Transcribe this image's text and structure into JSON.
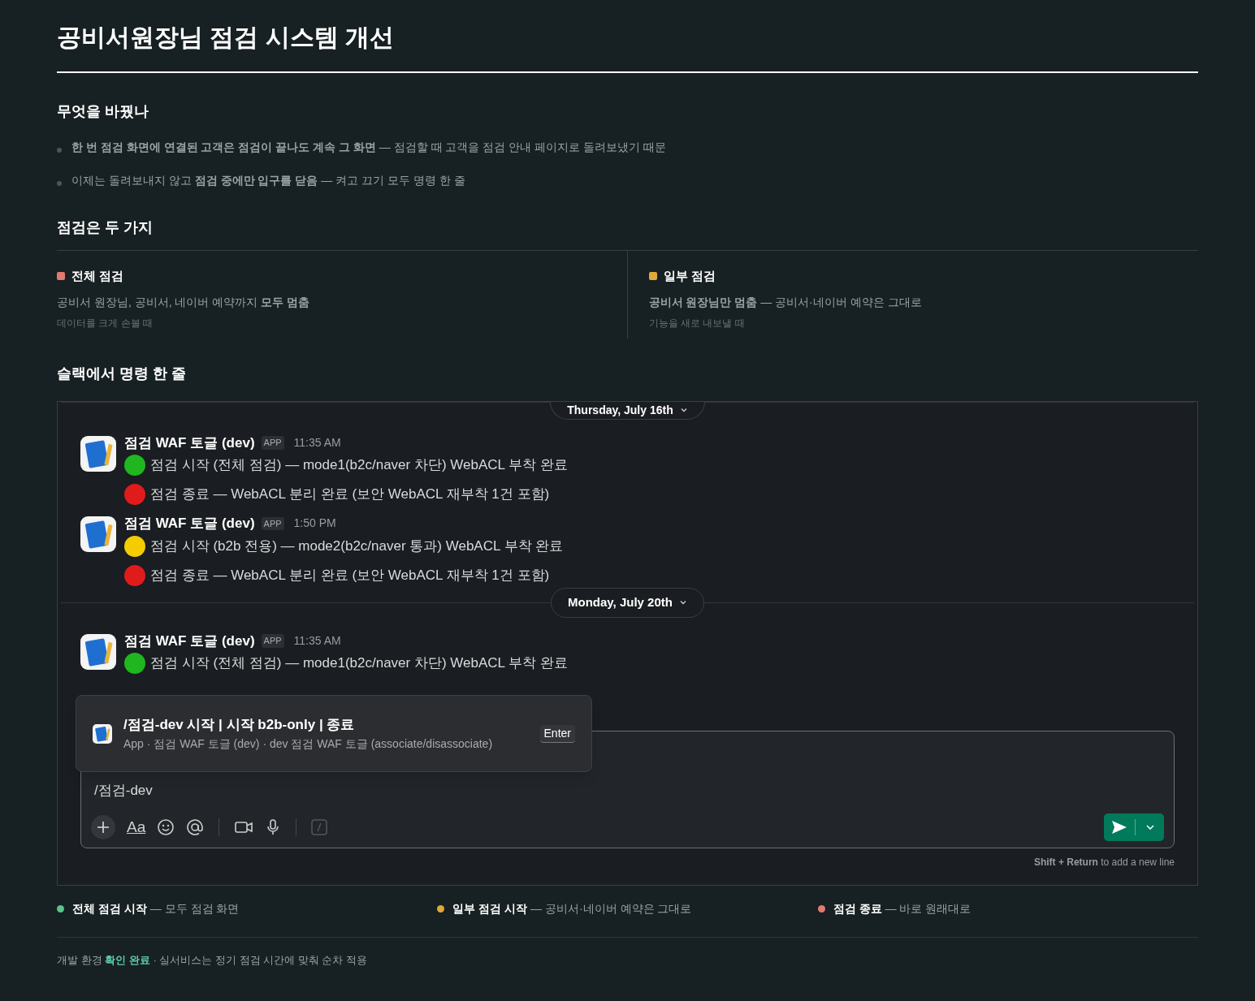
{
  "title": "공비서원장님 점검 시스템 개선",
  "changes": {
    "heading": "무엇을 바꿨나",
    "items": [
      "**한 번 점검 화면에 연결된 고객은 점검이 끝나도 계속 그 화면** — 점검할 때 고객을 점검 안내 페이지로 돌려보냈기 때문",
      "이제는 돌려보내지 않고 **점검 중에만 입구를 닫음** — 켜고 끄기 모두 명령 한 줄"
    ]
  },
  "modes": {
    "heading": "점검은 두 가지",
    "items": [
      {
        "name": "전체 점검",
        "color": "#e07a72",
        "desc": "공비서 원장님, 공비서, 네이버 예약까지 **모두 멈춤**",
        "when": "데이터를 크게 손볼 때"
      },
      {
        "name": "일부 점검",
        "color": "#e0a93a",
        "desc": "**공비서 원장님만 멈춤** — 공비서·네이버 예약은 그대로",
        "when": "기능을 새로 내보낼 때"
      }
    ]
  },
  "slack": {
    "heading": "슬랙에서 명령 한 줄",
    "days": [
      {
        "date": "Thursday, July 16th",
        "messages": [
          {
            "sender": "점검 WAF 토글 (dev)",
            "badge": "APP",
            "time": "11:35 AM",
            "lines": [
              {
                "color": "#1fb61f",
                "text": "점검 시작 (전체 점검) — mode1(b2c/naver 차단) WebACL 부착 완료"
              },
              {
                "color": "#e01b1b",
                "text": "점검 종료 — WebACL 분리 완료 (보안 WebACL 재부착 1건 포함)"
              }
            ]
          },
          {
            "sender": "점검 WAF 토글 (dev)",
            "badge": "APP",
            "time": "1:50 PM",
            "lines": [
              {
                "color": "#f5cc00",
                "text": "점검 시작 (b2b 전용) — mode2(b2c/naver 통과) WebACL 부착 완료"
              },
              {
                "color": "#e01b1b",
                "text": "점검 종료 — WebACL 분리 완료 (보안 WebACL 재부착 1건 포함)"
              }
            ]
          }
        ]
      },
      {
        "date": "Monday, July 20th",
        "messages": [
          {
            "sender": "점검 WAF 토글 (dev)",
            "badge": "APP",
            "time": "11:35 AM",
            "lines": [
              {
                "color": "#1fb61f",
                "text": "점검 시작 (전체 점검) — mode1(b2c/naver 차단) WebACL 부착 완료"
              }
            ]
          }
        ]
      }
    ],
    "suggestion": {
      "command": "/점검-dev 시작 | 시작 b2b-only | 종료",
      "detail": "App · 점검 WAF 토글 (dev) · dev 점검 WAF 토글 (associate/disassociate)",
      "key": "Enter"
    },
    "composer": {
      "value": "/점검-dev",
      "format_label": "Aa"
    },
    "hint": "**Shift + Return** to add a new line"
  },
  "legend": [
    {
      "color": "#5cc28e",
      "label": "전체 점검 시작",
      "desc": "— 모두 점검 화면"
    },
    {
      "color": "#e0a93a",
      "label": "일부 점검 시작",
      "desc": "— 공비서·네이버 예약은 그대로"
    },
    {
      "color": "#e07a72",
      "label": "점검 종료",
      "desc": "— 바로 원래대로"
    }
  ],
  "footer": "개발 환경 **확인 완료** · 실서비스는 정기 점검 시간에 맞춰 순차 적용"
}
